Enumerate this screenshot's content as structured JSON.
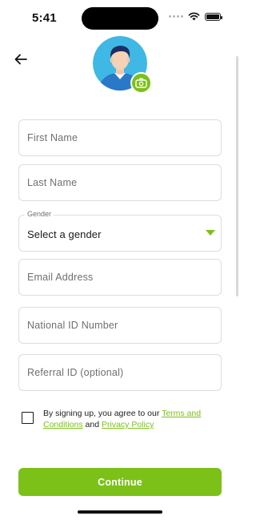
{
  "status_bar": {
    "time": "5:41",
    "icons": [
      "signal-dots-icon",
      "wifi-icon",
      "battery-icon"
    ]
  },
  "header": {
    "back_icon": "arrow-left-icon",
    "avatar_icon": "user-avatar",
    "camera_icon": "camera-rotate-icon"
  },
  "form": {
    "first_name": {
      "placeholder": "First Name",
      "value": ""
    },
    "last_name": {
      "placeholder": "Last Name",
      "value": ""
    },
    "gender": {
      "label": "Gender",
      "selected": "Select a gender",
      "caret_icon": "caret-down-icon"
    },
    "email": {
      "placeholder": "Email Address",
      "value": ""
    },
    "national_id": {
      "placeholder": "National ID Number",
      "value": ""
    },
    "referral_id": {
      "placeholder": "Referral ID (optional)",
      "value": ""
    }
  },
  "terms": {
    "checked": false,
    "prefix": "By signing up, you agree to our ",
    "terms_link": "Terms and Conditions",
    "conjunction": " and ",
    "privacy_link": "Privacy Policy"
  },
  "actions": {
    "continue_label": "Continue"
  },
  "colors": {
    "accent": "#7cc117",
    "border": "#dddddd",
    "placeholder": "#6f6f6f",
    "avatar_bg": "#3fb8e6"
  }
}
